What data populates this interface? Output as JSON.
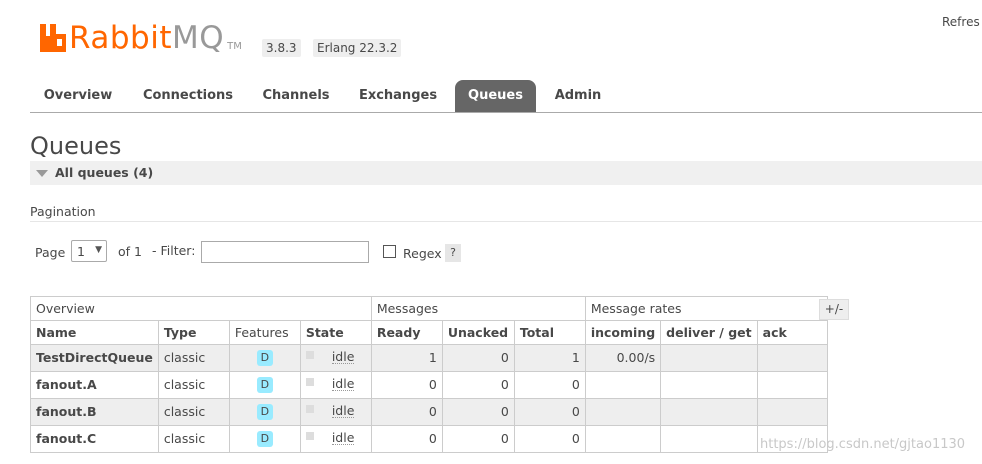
{
  "header": {
    "logo_rabbit": "Rabbit",
    "logo_mq": "MQ",
    "logo_tm": "TM",
    "rabbitmq_version": "3.8.3",
    "erlang_version": "Erlang 22.3.2",
    "refresh_label": "Refres",
    "brand_color": "#ff6600"
  },
  "nav": {
    "tabs": [
      {
        "label": "Overview",
        "active": false
      },
      {
        "label": "Connections",
        "active": false
      },
      {
        "label": "Channels",
        "active": false
      },
      {
        "label": "Exchanges",
        "active": false
      },
      {
        "label": "Queues",
        "active": true
      },
      {
        "label": "Admin",
        "active": false
      }
    ]
  },
  "page": {
    "title": "Queues",
    "section_title": "All queues (4)",
    "pagination_label": "Pagination"
  },
  "pagination": {
    "page_label": "Page",
    "page_value": "1",
    "of_label": "of 1",
    "filter_label": "- Filter:",
    "filter_value": "",
    "regex_label": "Regex",
    "regex_checked": false,
    "help_label": "?"
  },
  "table": {
    "group_headers": [
      "Overview",
      "Messages",
      "Message rates"
    ],
    "columns": [
      "Name",
      "Type",
      "Features",
      "State",
      "Ready",
      "Unacked",
      "Total",
      "incoming",
      "deliver / get",
      "ack"
    ],
    "toggle_label": "+/-",
    "rows": [
      {
        "name": "TestDirectQueue",
        "type": "classic",
        "feature": "D",
        "state": "idle",
        "ready": "1",
        "unacked": "0",
        "total": "1",
        "incoming": "0.00/s",
        "deliver": "",
        "ack": ""
      },
      {
        "name": "fanout.A",
        "type": "classic",
        "feature": "D",
        "state": "idle",
        "ready": "0",
        "unacked": "0",
        "total": "0",
        "incoming": "",
        "deliver": "",
        "ack": ""
      },
      {
        "name": "fanout.B",
        "type": "classic",
        "feature": "D",
        "state": "idle",
        "ready": "0",
        "unacked": "0",
        "total": "0",
        "incoming": "",
        "deliver": "",
        "ack": ""
      },
      {
        "name": "fanout.C",
        "type": "classic",
        "feature": "D",
        "state": "idle",
        "ready": "0",
        "unacked": "0",
        "total": "0",
        "incoming": "",
        "deliver": "",
        "ack": ""
      }
    ]
  },
  "watermark": "https://blog.csdn.net/gjtao1130"
}
